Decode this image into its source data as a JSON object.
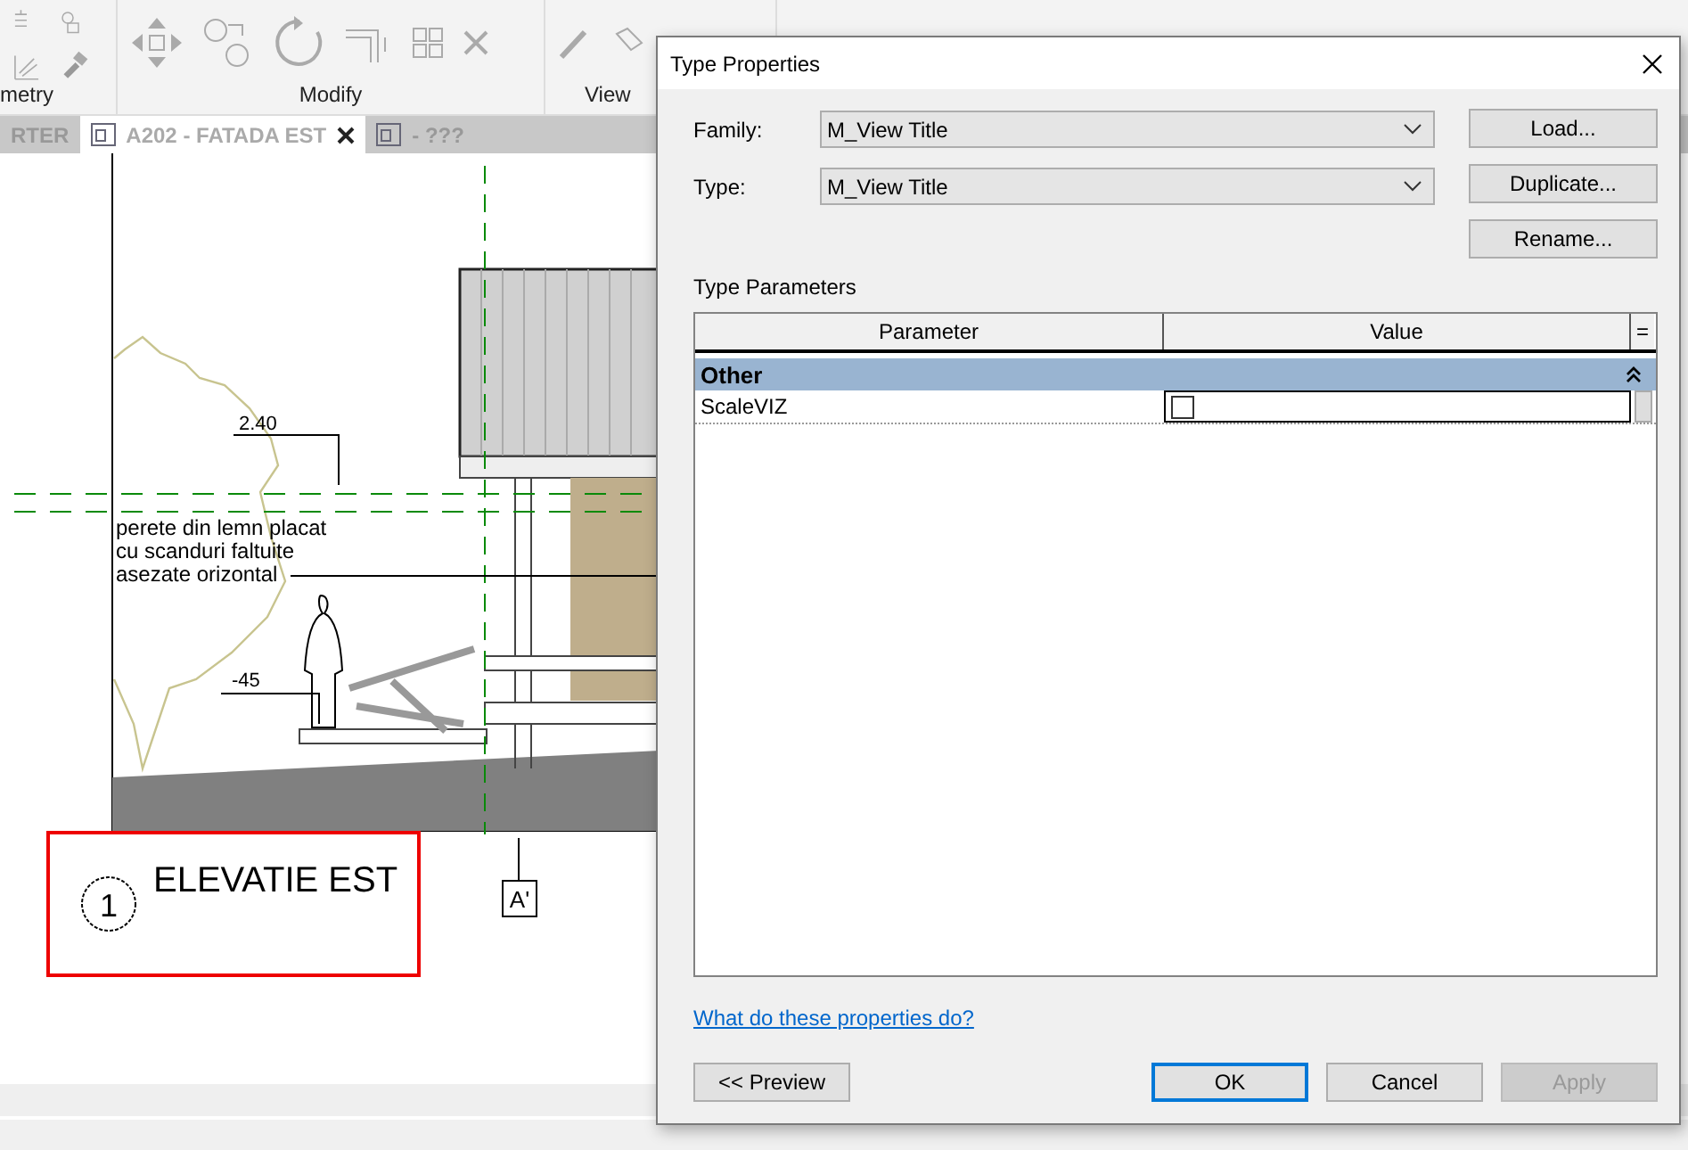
{
  "ribbon": {
    "panels": [
      {
        "label": "metry"
      },
      {
        "label": "Modify"
      },
      {
        "label": "View"
      }
    ]
  },
  "view_tabs": [
    {
      "label": "RTER",
      "selected": false,
      "closable": false,
      "icon": false
    },
    {
      "label": "A202 - FATADA EST",
      "selected": true,
      "closable": true,
      "icon": true
    },
    {
      "label": "- ???",
      "selected": false,
      "closable": false,
      "icon": true
    }
  ],
  "drawing": {
    "dimension_labels": [
      "2.40",
      "-45"
    ],
    "note_lines": [
      "perete din lemn placat",
      "cu scanduri faltuite",
      "asezate orizontal"
    ],
    "view_title": {
      "number": "1",
      "name": "ELEVATIE EST"
    },
    "grid_tag": "A'"
  },
  "dialog": {
    "title": "Type Properties",
    "fields": [
      {
        "label": "Family:",
        "value": "M_View Title"
      },
      {
        "label": "Type:",
        "value": "M_View Title"
      }
    ],
    "side_buttons": [
      "Load...",
      "Duplicate...",
      "Rename..."
    ],
    "section_label": "Type Parameters",
    "table": {
      "columns": [
        "Parameter",
        "Value",
        "="
      ],
      "groups": [
        {
          "name": "Other",
          "expanded": true,
          "rows": [
            {
              "parameter": "ScaleVIZ",
              "kind": "checkbox",
              "checked": false
            }
          ]
        }
      ]
    },
    "help_link": "What do these properties do?",
    "footer_buttons": [
      {
        "label": "<< Preview",
        "default": false,
        "disabled": false
      },
      {
        "label": "OK",
        "default": true,
        "disabled": false
      },
      {
        "label": "Cancel",
        "default": false,
        "disabled": false
      },
      {
        "label": "Apply",
        "default": false,
        "disabled": true
      }
    ]
  }
}
